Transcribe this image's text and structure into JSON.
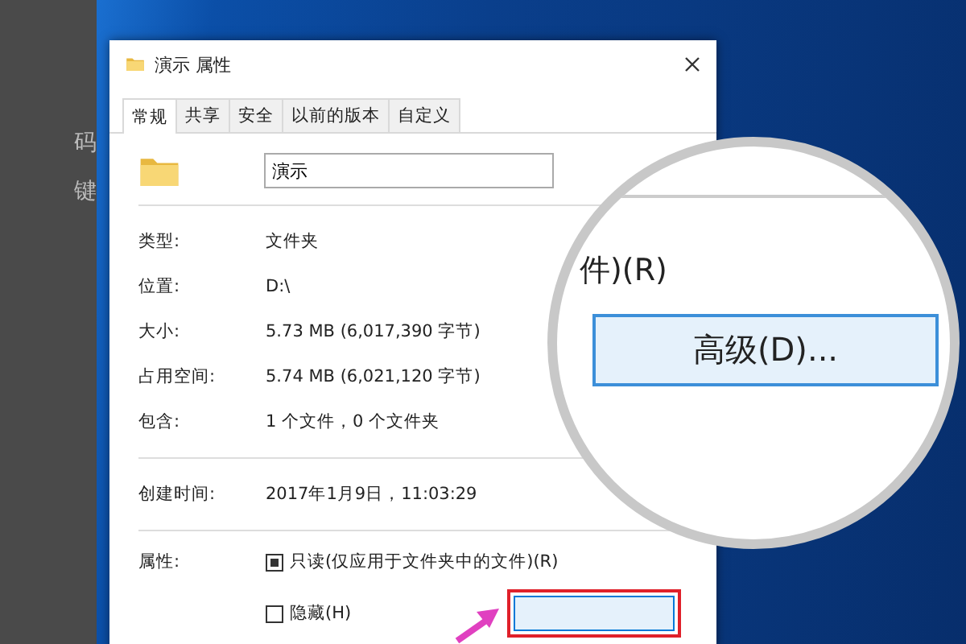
{
  "background_window": {
    "fragments": [
      "码",
      "键"
    ]
  },
  "dialog": {
    "title": "演示 属性",
    "tabs": [
      {
        "label": "常规",
        "selected": true
      },
      {
        "label": "共享",
        "selected": false
      },
      {
        "label": "安全",
        "selected": false
      },
      {
        "label": "以前的版本",
        "selected": false
      },
      {
        "label": "自定义",
        "selected": false
      }
    ],
    "name_field": {
      "value": "演示"
    },
    "sections": [
      [
        {
          "label": "类型:",
          "value": "文件夹"
        },
        {
          "label": "位置:",
          "value": "D:\\"
        },
        {
          "label": "大小:",
          "value": "5.73 MB (6,017,390 字节)"
        },
        {
          "label": "占用空间:",
          "value": "5.74 MB (6,021,120 字节)"
        },
        {
          "label": "包含:",
          "value": "1 个文件，0 个文件夹"
        }
      ],
      [
        {
          "label": "创建时间:",
          "value": "2017年1月9日，11:03:29"
        }
      ]
    ],
    "attributes": {
      "label": "属性:",
      "options": [
        {
          "label": "只读(仅应用于文件夹中的文件)(R)",
          "checked": true
        },
        {
          "label": "隐藏(H)",
          "checked": false
        }
      ]
    },
    "advanced_button": {
      "highlighted": true
    }
  },
  "magnifier": {
    "caption": "件)(R)",
    "button": "高级(D)..."
  }
}
